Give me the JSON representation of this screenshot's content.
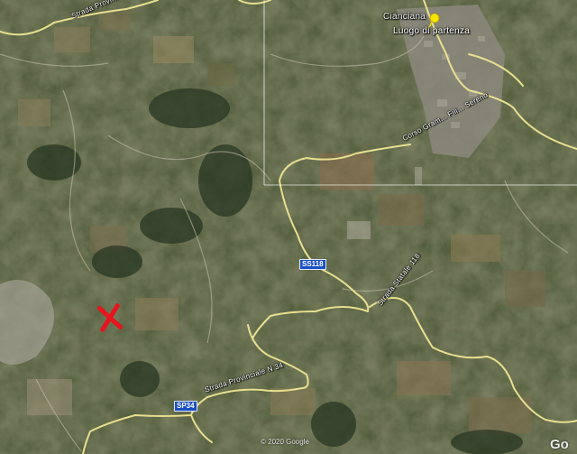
{
  "map": {
    "place_name": "Cianciana",
    "start_label": "Luogo di partenza",
    "road_labels": {
      "sp_north": "Strada Provinciale N 32",
      "corso": "Corso Gram... Fili... Sereno",
      "sp_east": "Strada Statale 118",
      "sp_south": "Strada Provinciale N 34"
    },
    "shields": {
      "ss118": "SS118",
      "sp34": "SP34"
    },
    "copyright": "© 2020 Google",
    "logo": "Go",
    "colors": {
      "road": "#e8df8f",
      "crosshair": "#ffffff",
      "marker_pin": "#f5e400",
      "marker_x": "#e8141e"
    },
    "markers": {
      "start_icon": "pushpin-icon",
      "destination_icon": "x-marker-icon"
    }
  }
}
